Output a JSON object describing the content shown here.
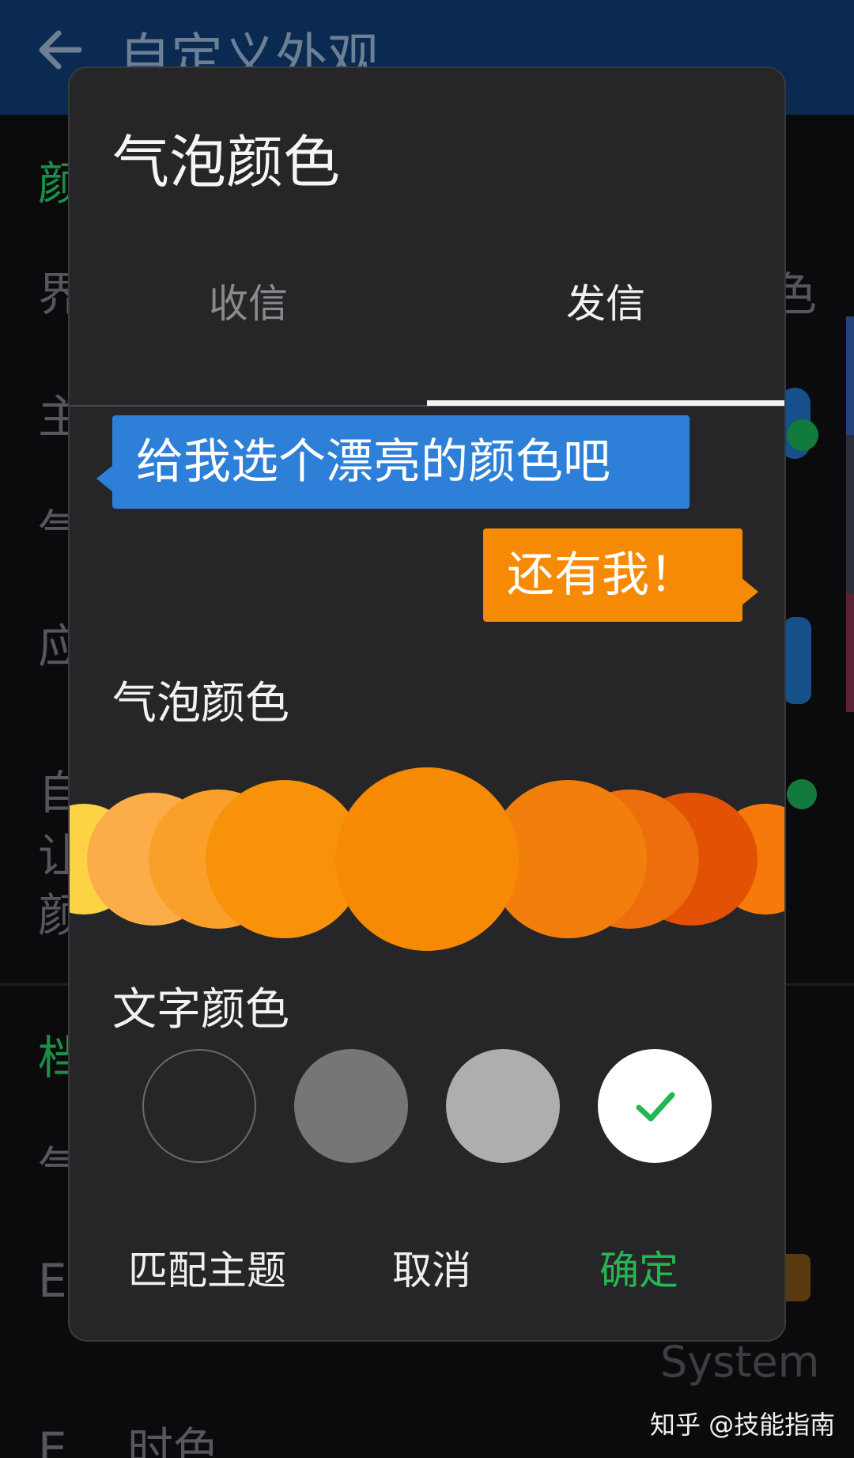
{
  "app": {
    "title": "自定义外观",
    "background": {
      "partial_texts": [
        "颜",
        "界",
        "主",
        "气",
        "应",
        "自",
        "让",
        "颜",
        "档",
        "气",
        "E"
      ],
      "right_partial": "色",
      "bottom_row": "E   …时色",
      "system_label": "System"
    }
  },
  "watermark": "知乎 @技能指南",
  "dialog": {
    "title": "气泡颜色",
    "tabs": [
      {
        "label": "收信",
        "selected": false
      },
      {
        "label": "发信",
        "selected": true
      }
    ],
    "preview": {
      "incoming_text": "给我选个漂亮的颜色吧",
      "outgoing_text": "还有我！",
      "incoming_color": "#2d7fd8",
      "outgoing_color": "#f68a05"
    },
    "bubble_color_label": "气泡颜色",
    "bubble_colors": [
      "#fbd345",
      "#fcac48",
      "#faa02a",
      "#f8920a",
      "#f68a05",
      "#f27e0c",
      "#ec6e0c",
      "#e35204",
      "#f57a0b"
    ],
    "selected_bubble_color": "#f68a05",
    "text_color_label": "文字颜色",
    "text_colors": [
      {
        "color": "#262628",
        "selected": false
      },
      {
        "color": "#767678",
        "selected": false
      },
      {
        "color": "#aeaeb1",
        "selected": false
      },
      {
        "color": "#ffffff",
        "selected": true
      }
    ],
    "check_color": "#26b552",
    "actions": {
      "match_theme": "匹配主题",
      "cancel": "取消",
      "confirm": "确定"
    }
  }
}
